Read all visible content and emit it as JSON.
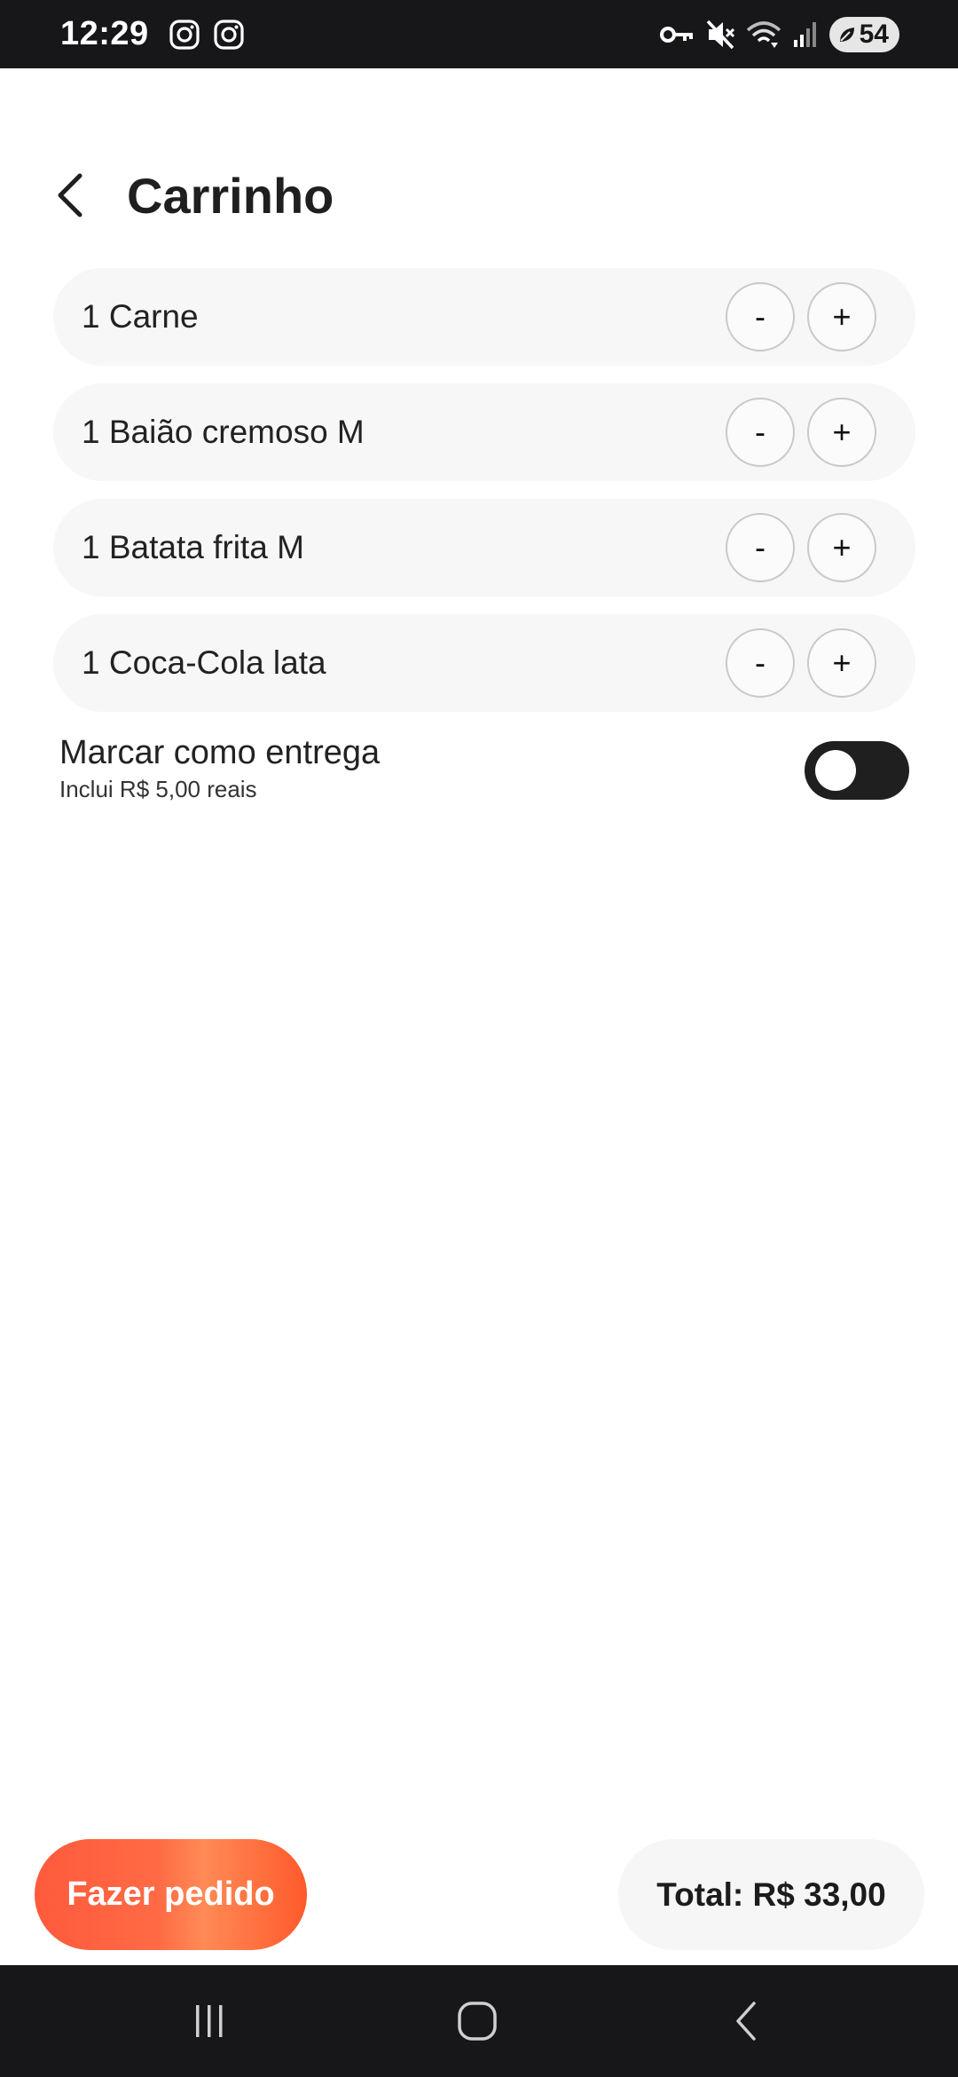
{
  "status_bar": {
    "time": "12:29",
    "battery": "54",
    "icons": [
      "instagram-icon",
      "instagram-icon",
      "vpn-key-icon",
      "mute-icon",
      "wifi-icon",
      "signal-icon",
      "battery-icon"
    ]
  },
  "header": {
    "title": "Carrinho",
    "back_icon": "chevron-left-icon"
  },
  "cart": {
    "items": [
      {
        "label": "1 Carne",
        "minus": "-",
        "plus": "+"
      },
      {
        "label": "1 Baião cremoso M",
        "minus": "-",
        "plus": "+"
      },
      {
        "label": "1 Batata frita M",
        "minus": "-",
        "plus": "+"
      },
      {
        "label": "1 Coca-Cola lata",
        "minus": "-",
        "plus": "+"
      }
    ]
  },
  "delivery": {
    "label": "Marcar como entrega",
    "sublabel": "Inclui R$ 5,00 reais",
    "enabled": false
  },
  "footer": {
    "order_button": "Fazer pedido",
    "total": "Total: R$ 33,00"
  },
  "colors": {
    "accent": "#ff5a3c",
    "toggle_track": "#1f1f1f",
    "system_bars": "#17171a"
  }
}
